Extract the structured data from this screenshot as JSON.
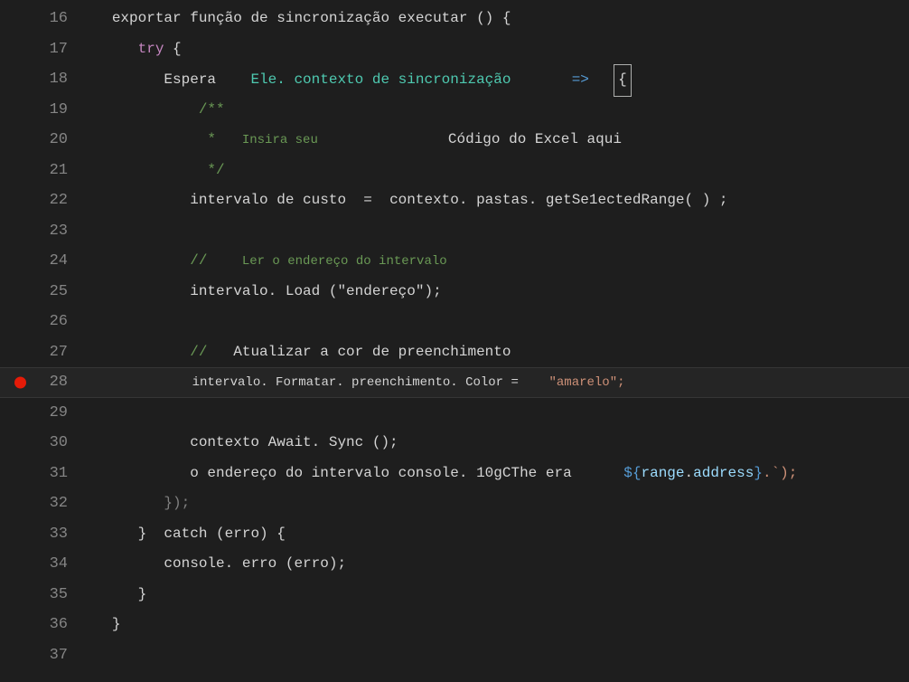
{
  "lines": {
    "l16": "16",
    "l17": "17",
    "l18": "18",
    "l19": "19",
    "l20": "20",
    "l21": "21",
    "l22": "22",
    "l23": "23",
    "l24": "24",
    "l25": "25",
    "l26": "26",
    "l27": "27",
    "l28": "28",
    "l29": "29",
    "l30": "30",
    "l31": "31",
    "l32": "32",
    "l33": "33",
    "l34": "34",
    "l35": "35",
    "l36": "36",
    "l37": "37"
  },
  "code": {
    "l16_export": "exportar função de sincronização executar () {",
    "l17_try": "try",
    "l17_brace": " {",
    "l18_espera": "Espera",
    "l18_ele": "Ele. contexto de sincronização",
    "l18_arrow": "=>",
    "l18_brace": "{",
    "l19_comment": "/**",
    "l20_star": " *",
    "l20_insira": "Insira seu",
    "l20_codigo": "Código do Excel aqui",
    "l21_comment": " */",
    "l22_intervalo": "intervalo de custo",
    "l22_eq": "=",
    "l22_contexto": "contexto. pastas. getSe1ectedRange( ) ;",
    "l24_comment": "//",
    "l24_ler": "Ler o endereço do intervalo",
    "l25_intervalo": "intervalo. Load (\"endereço\");",
    "l27_comment": "//",
    "l27_atualizar": "Atualizar a cor de preenchimento",
    "l28_intervalo": "intervalo. Formatar. preenchimento. Color =",
    "l28_string": "\"amarelo\";",
    "l30_await": "contexto Await. Sync ();",
    "l31_endereco": "o endereço do intervalo console. 10gCThe era",
    "l31_template": "${",
    "l31_range": "range",
    "l31_dot": ".",
    "l31_address": "address",
    "l31_template_end": "}",
    "l31_end": ".`);",
    "l32_close": "});",
    "l33_brace": "}",
    "l33_catch": "catch (erro) {",
    "l34_console": "console. erro (erro);",
    "l35_brace": "}",
    "l36_brace": "}"
  }
}
